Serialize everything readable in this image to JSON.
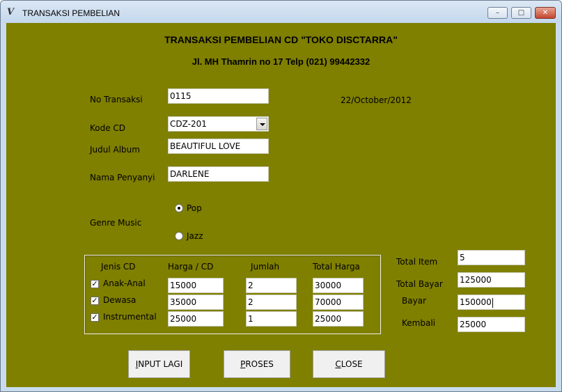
{
  "window": {
    "title": "TRANSAKSI PEMBELIAN",
    "app_icon": "vb-form-icon",
    "controls": {
      "minimize": "–",
      "maximize": "□",
      "close": "✕"
    }
  },
  "header": {
    "title": "TRANSAKSI PEMBELIAN CD \"TOKO DISCTARRA\"",
    "address": "Jl. MH Thamrin no 17 Telp (021) 99442332"
  },
  "form": {
    "no_transaksi": {
      "label": "No Transaksi",
      "value": "0115"
    },
    "date": "22/October/2012",
    "kode_cd": {
      "label": "Kode CD",
      "value": "CDZ-201"
    },
    "judul_album": {
      "label": "Judul Album",
      "value": "BEAUTIFUL LOVE"
    },
    "nama_penyanyi": {
      "label": "Nama Penyanyi",
      "value": "DARLENE"
    },
    "genre": {
      "label": "Genre Music",
      "options": [
        {
          "label": "Pop",
          "selected": true
        },
        {
          "label": "Jazz",
          "selected": false
        }
      ]
    }
  },
  "cd_table": {
    "headers": {
      "jenis": "Jenis CD",
      "harga": "Harga / CD",
      "jumlah": "Jumlah",
      "total": "Total Harga"
    },
    "rows": [
      {
        "jenis": "Anak-Anal",
        "checked": true,
        "harga": "15000",
        "jumlah": "2",
        "total": "30000"
      },
      {
        "jenis": "Dewasa",
        "checked": true,
        "harga": "35000",
        "jumlah": "2",
        "total": "70000"
      },
      {
        "jenis": "Instrumental",
        "checked": true,
        "harga": "25000",
        "jumlah": "1",
        "total": "25000"
      }
    ]
  },
  "summary": {
    "total_item": {
      "label": "Total Item",
      "value": "5"
    },
    "total_bayar": {
      "label": "Total Bayar",
      "value": "125000"
    },
    "bayar": {
      "label": "Bayar",
      "value": "150000"
    },
    "kembali": {
      "label": "Kembali",
      "value": "25000"
    }
  },
  "buttons": {
    "input_lagi": {
      "mnemonic": "I",
      "rest": "NPUT LAGI"
    },
    "proses": {
      "mnemonic": "P",
      "rest": "ROSES"
    },
    "close": {
      "mnemonic": "C",
      "rest": "LOSE"
    }
  },
  "colors": {
    "form_background": "#7f7f00",
    "titlebar": "#c9dcee",
    "close_button": "#c4462f"
  }
}
